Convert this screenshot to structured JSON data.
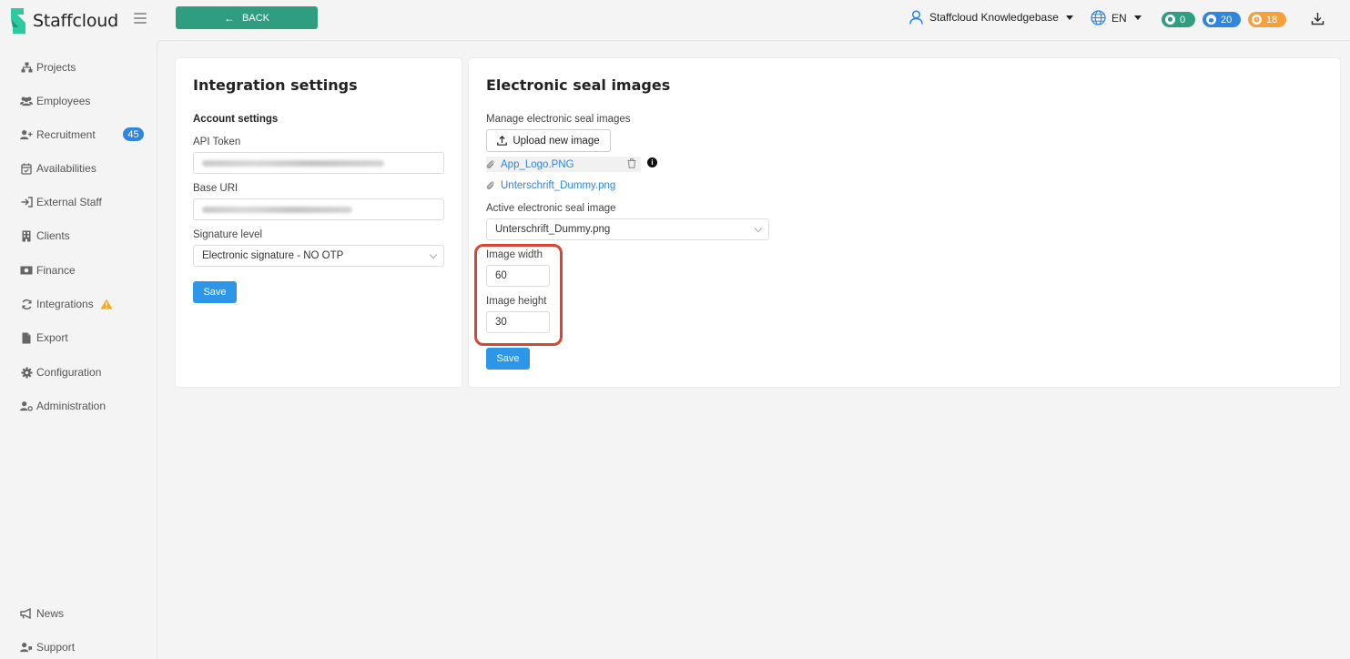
{
  "brand": {
    "name": "Staffcloud"
  },
  "topbar": {
    "back_label": "BACK",
    "user_label": "Staffcloud Knowledgebase",
    "lang_label": "EN",
    "messages_count": "0",
    "notifications_count": "20",
    "pending_count": "18"
  },
  "sidebar": {
    "items": [
      {
        "label": "Projects",
        "icon": "sitemap-icon"
      },
      {
        "label": "Employees",
        "icon": "users-icon"
      },
      {
        "label": "Recruitment",
        "icon": "user-plus-icon",
        "badge": "45"
      },
      {
        "label": "Availabilities",
        "icon": "calendar-check-icon"
      },
      {
        "label": "External Staff",
        "icon": "sign-in-icon"
      },
      {
        "label": "Clients",
        "icon": "building-icon"
      },
      {
        "label": "Finance",
        "icon": "money-icon"
      },
      {
        "label": "Integrations",
        "icon": "sync-icon",
        "warning": true
      },
      {
        "label": "Export",
        "icon": "file-icon"
      },
      {
        "label": "Configuration",
        "icon": "cog-icon"
      },
      {
        "label": "Administration",
        "icon": "user-cog-icon"
      }
    ],
    "bottom_items": [
      {
        "label": "News",
        "icon": "megaphone-icon"
      },
      {
        "label": "Support",
        "icon": "support-icon"
      }
    ]
  },
  "integration": {
    "title": "Integration settings",
    "account_heading": "Account settings",
    "api_token_label": "API Token",
    "base_uri_label": "Base URI",
    "signature_label": "Signature level",
    "signature_value": "Electronic signature - NO OTP",
    "save_label": "Save"
  },
  "seal": {
    "title": "Electronic seal images",
    "manage_label": "Manage electronic seal images",
    "upload_label": "Upload new image",
    "files": [
      "App_Logo.PNG",
      "Unterschrift_Dummy.png"
    ],
    "active_label": "Active electronic seal image",
    "active_value": "Unterschrift_Dummy.png",
    "width_label": "Image width",
    "width_value": "60",
    "height_label": "Image height",
    "height_value": "30",
    "save_label": "Save"
  },
  "colors": {
    "brand_green": "#2f9d80",
    "accent_blue": "#2e96e8",
    "warning_orange": "#f5a03a",
    "highlight_red": "#d64535"
  }
}
